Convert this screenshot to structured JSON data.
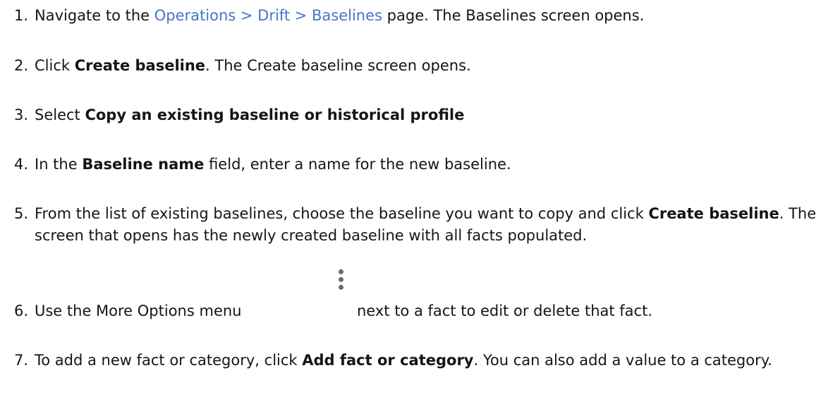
{
  "steps": [
    {
      "number": "1.",
      "parts": [
        "Navigate to the ",
        "Operations > Drift > Baselines",
        " page. The Baselines screen opens."
      ]
    },
    {
      "number": "2.",
      "parts": [
        "Click ",
        "Create baseline",
        ". The Create baseline screen opens."
      ]
    },
    {
      "number": "3.",
      "parts": [
        "Select ",
        "Copy an existing baseline or historical profile"
      ]
    },
    {
      "number": "4.",
      "parts": [
        "In the ",
        "Baseline name",
        " field, enter a name for the new baseline."
      ]
    },
    {
      "number": "5.",
      "parts": [
        "From the list of existing baselines, choose the baseline you want to copy and click ",
        "Create baseline",
        ". The screen that opens has the newly created baseline with all facts populated."
      ]
    },
    {
      "number": "6.",
      "parts": [
        "Use the More Options menu",
        "next to a fact to edit or delete that fact."
      ],
      "icon": "kebab-vertical-icon"
    },
    {
      "number": "7.",
      "parts": [
        "To add a new fact or category, click ",
        "Add fact or category",
        ". You can also add a value to a category."
      ]
    }
  ]
}
